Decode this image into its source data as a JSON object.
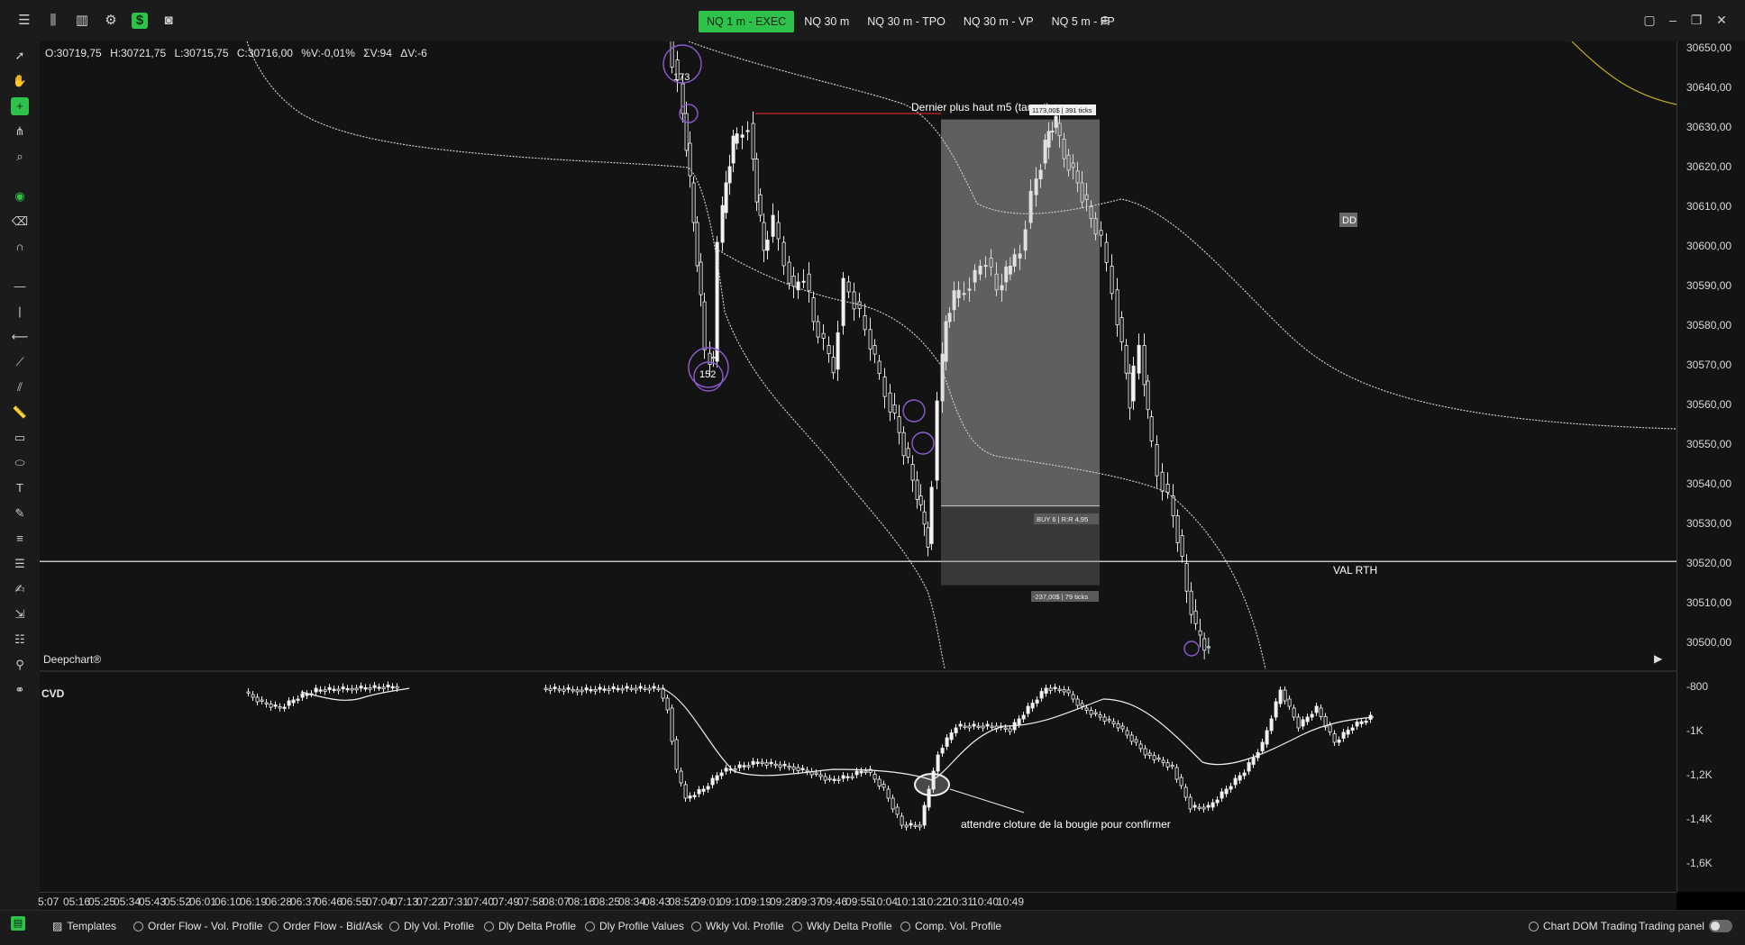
{
  "toolbar": {
    "tabs": [
      {
        "label": "NQ 1 m - EXEC",
        "active": true
      },
      {
        "label": "NQ 30 m",
        "active": false
      },
      {
        "label": "NQ 30 m - TPO",
        "active": false
      },
      {
        "label": "NQ 30 m - VP",
        "active": false
      },
      {
        "label": "NQ 5 m - FP",
        "active": false
      }
    ],
    "add_tab_icon": "plus-circle-icon"
  },
  "ohlc": {
    "o": "O:30719,75",
    "h": "H:30721,75",
    "l": "L:30715,75",
    "c": "C:30716,00",
    "pv": "%V:-0,01%",
    "sv": "ΣV:94",
    "dv": "ΔV:-6"
  },
  "chart": {
    "brand": "Deepchart®",
    "cvd_label": "CVD",
    "price_labels": [
      "30650,00",
      "30640,00",
      "30630,00",
      "30620,00",
      "30610,00",
      "30600,00",
      "30590,00",
      "30580,00",
      "30570,00",
      "30560,00",
      "30550,00",
      "30540,00",
      "30530,00",
      "30520,00",
      "30510,00",
      "30500,00"
    ],
    "cvd_labels": [
      "-800",
      "-1K",
      "-1,2K",
      "-1,4K",
      "-1,6K"
    ],
    "time_labels": [
      "5:07",
      "05:16",
      "05:25",
      "05:34",
      "05:43",
      "05:52",
      "06:01",
      "06:10",
      "06:19",
      "06:28",
      "06:37",
      "06:46",
      "06:55",
      "07:04",
      "07:13",
      "07:22",
      "07:31",
      "07:40",
      "07:49",
      "07:58",
      "08:07",
      "08:16",
      "08:25",
      "08:34",
      "08:43",
      "08:52",
      "09:01",
      "09:10",
      "09:19",
      "09:28",
      "09:37",
      "09:46",
      "09:55",
      "10:04",
      "10:13",
      "10:22",
      "10:31",
      "10:40",
      "10:49"
    ],
    "annotations": {
      "target": "Dernier plus haut m5 (target)",
      "target_box": "1173,00$ | 391 ticks",
      "buy_box": "BUY 6 | R:R 4,95",
      "stop_box": "-237,00$ | 79 ticks",
      "val_rth": "VAL RTH",
      "dd": "DD",
      "circle_173": "173",
      "circle_152": "152",
      "cvd_note": "attendre cloture de la bougie pour confirmer"
    }
  },
  "bottom": {
    "templates": "Templates",
    "items": [
      "Order Flow - Vol. Profile",
      "Order Flow - Bid/Ask",
      "Dly Vol. Profile",
      "Dly Delta Profile",
      "Dly Profile Values",
      "Wkly Vol. Profile",
      "Wkly Delta Profile",
      "Comp. Vol. Profile"
    ],
    "chart_dom": "Chart DOM Trading",
    "trading_panel": "Trading panel"
  }
}
